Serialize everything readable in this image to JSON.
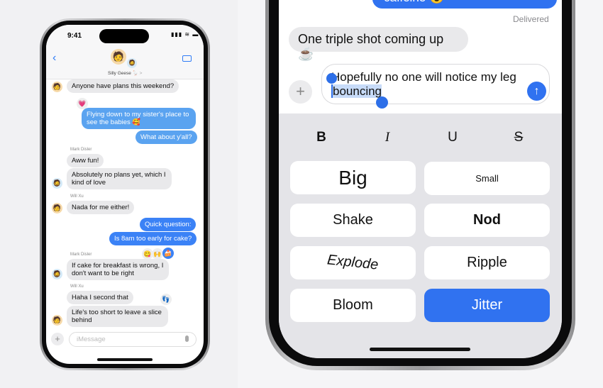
{
  "left_phone": {
    "status": {
      "time": "9:41"
    },
    "header": {
      "group_name": "Silly Geese 🪿",
      "chevron": ">",
      "back_icon": "chevron-left-icon",
      "video_icon": "video-icon"
    },
    "messages": [
      {
        "sender": "",
        "text": "Anyone have plans this weekend?",
        "dir": "in"
      },
      {
        "text": "Flying down to my sister's place to see the babies 🥰",
        "dir": "out",
        "tapback": "💗"
      },
      {
        "text": "What about y'all?",
        "dir": "out"
      },
      {
        "sender": "Mark Disler",
        "text": "Aww fun!",
        "dir": "in"
      },
      {
        "text": "Absolutely no plans yet, which I kind of love",
        "dir": "in"
      },
      {
        "sender": "Will Xu",
        "text": "Nada for me either!",
        "dir": "in"
      },
      {
        "text": "Quick question:",
        "dir": "out"
      },
      {
        "text": "Is 8am too early for cake?",
        "dir": "out",
        "tapbacks": [
          "😋",
          "🙌",
          "🍰"
        ]
      },
      {
        "sender": "Mark Disler",
        "text": "If cake for breakfast is wrong, I don't want to be right",
        "dir": "in"
      },
      {
        "sender": "Will Xu",
        "text": "Haha I second that",
        "dir": "in",
        "tapback": "👣"
      },
      {
        "text": "Life's too short to leave a slice behind",
        "dir": "in"
      }
    ],
    "composer": {
      "placeholder": "iMessage",
      "plus": "+",
      "mic_icon": "mic-icon"
    }
  },
  "right_phone": {
    "top_message": "caffeine 😮",
    "status": "Delivered",
    "incoming": "One triple shot coming up ☕",
    "draft_line1": "Hopefully no one will notice my leg",
    "draft_selected": "bouncing",
    "plus": "+",
    "send_icon": "arrow-up-icon",
    "format": [
      "B",
      "I",
      "U",
      "S"
    ],
    "effects": [
      "Big",
      "Small",
      "Shake",
      "Nod",
      "Explode",
      "Ripple",
      "Bloom",
      "Jitter"
    ],
    "selected_effect": "Jitter",
    "accent": "#3072f0"
  }
}
